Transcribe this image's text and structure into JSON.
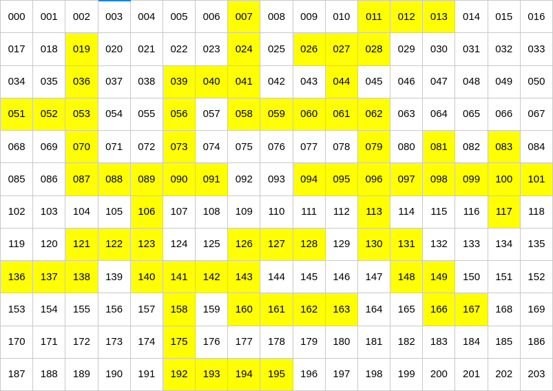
{
  "grid": {
    "columns": 17,
    "highlight_color": "#ffff00",
    "cells": [
      {
        "label": "000",
        "hl": false
      },
      {
        "label": "001",
        "hl": false
      },
      {
        "label": "002",
        "hl": false
      },
      {
        "label": "003",
        "hl": false
      },
      {
        "label": "004",
        "hl": false
      },
      {
        "label": "005",
        "hl": false
      },
      {
        "label": "006",
        "hl": false
      },
      {
        "label": "007",
        "hl": true
      },
      {
        "label": "008",
        "hl": false
      },
      {
        "label": "009",
        "hl": false
      },
      {
        "label": "010",
        "hl": false
      },
      {
        "label": "011",
        "hl": true
      },
      {
        "label": "012",
        "hl": true
      },
      {
        "label": "013",
        "hl": true
      },
      {
        "label": "014",
        "hl": false
      },
      {
        "label": "015",
        "hl": false
      },
      {
        "label": "016",
        "hl": false
      },
      {
        "label": "017",
        "hl": false
      },
      {
        "label": "018",
        "hl": false
      },
      {
        "label": "019",
        "hl": true
      },
      {
        "label": "020",
        "hl": false
      },
      {
        "label": "021",
        "hl": false
      },
      {
        "label": "022",
        "hl": false
      },
      {
        "label": "023",
        "hl": false
      },
      {
        "label": "024",
        "hl": true
      },
      {
        "label": "025",
        "hl": false
      },
      {
        "label": "026",
        "hl": true
      },
      {
        "label": "027",
        "hl": true
      },
      {
        "label": "028",
        "hl": true
      },
      {
        "label": "029",
        "hl": false
      },
      {
        "label": "030",
        "hl": false
      },
      {
        "label": "031",
        "hl": false
      },
      {
        "label": "032",
        "hl": false
      },
      {
        "label": "033",
        "hl": false
      },
      {
        "label": "034",
        "hl": false
      },
      {
        "label": "035",
        "hl": false
      },
      {
        "label": "036",
        "hl": true
      },
      {
        "label": "037",
        "hl": false
      },
      {
        "label": "038",
        "hl": false
      },
      {
        "label": "039",
        "hl": true
      },
      {
        "label": "040",
        "hl": true
      },
      {
        "label": "041",
        "hl": true
      },
      {
        "label": "042",
        "hl": false
      },
      {
        "label": "043",
        "hl": false
      },
      {
        "label": "044",
        "hl": true
      },
      {
        "label": "045",
        "hl": false
      },
      {
        "label": "046",
        "hl": false
      },
      {
        "label": "047",
        "hl": false
      },
      {
        "label": "048",
        "hl": false
      },
      {
        "label": "049",
        "hl": false
      },
      {
        "label": "050",
        "hl": false
      },
      {
        "label": "051",
        "hl": true
      },
      {
        "label": "052",
        "hl": true
      },
      {
        "label": "053",
        "hl": true
      },
      {
        "label": "054",
        "hl": false
      },
      {
        "label": "055",
        "hl": false
      },
      {
        "label": "056",
        "hl": true
      },
      {
        "label": "057",
        "hl": false
      },
      {
        "label": "058",
        "hl": true
      },
      {
        "label": "059",
        "hl": true
      },
      {
        "label": "060",
        "hl": true
      },
      {
        "label": "061",
        "hl": true
      },
      {
        "label": "062",
        "hl": true
      },
      {
        "label": "063",
        "hl": false
      },
      {
        "label": "064",
        "hl": false
      },
      {
        "label": "065",
        "hl": false
      },
      {
        "label": "066",
        "hl": false
      },
      {
        "label": "067",
        "hl": false
      },
      {
        "label": "068",
        "hl": false
      },
      {
        "label": "069",
        "hl": false
      },
      {
        "label": "070",
        "hl": true
      },
      {
        "label": "071",
        "hl": false
      },
      {
        "label": "072",
        "hl": false
      },
      {
        "label": "073",
        "hl": true
      },
      {
        "label": "074",
        "hl": false
      },
      {
        "label": "075",
        "hl": false
      },
      {
        "label": "076",
        "hl": false
      },
      {
        "label": "077",
        "hl": false
      },
      {
        "label": "078",
        "hl": false
      },
      {
        "label": "079",
        "hl": true
      },
      {
        "label": "080",
        "hl": false
      },
      {
        "label": "081",
        "hl": true
      },
      {
        "label": "082",
        "hl": false
      },
      {
        "label": "083",
        "hl": true
      },
      {
        "label": "084",
        "hl": false
      },
      {
        "label": "085",
        "hl": false
      },
      {
        "label": "086",
        "hl": false
      },
      {
        "label": "087",
        "hl": true
      },
      {
        "label": "088",
        "hl": true
      },
      {
        "label": "089",
        "hl": true
      },
      {
        "label": "090",
        "hl": true
      },
      {
        "label": "091",
        "hl": true
      },
      {
        "label": "092",
        "hl": false
      },
      {
        "label": "093",
        "hl": false
      },
      {
        "label": "094",
        "hl": true
      },
      {
        "label": "095",
        "hl": true
      },
      {
        "label": "096",
        "hl": true
      },
      {
        "label": "097",
        "hl": true
      },
      {
        "label": "098",
        "hl": true
      },
      {
        "label": "099",
        "hl": true
      },
      {
        "label": "100",
        "hl": true
      },
      {
        "label": "101",
        "hl": true
      },
      {
        "label": "102",
        "hl": false
      },
      {
        "label": "103",
        "hl": false
      },
      {
        "label": "104",
        "hl": false
      },
      {
        "label": "105",
        "hl": false
      },
      {
        "label": "106",
        "hl": true
      },
      {
        "label": "107",
        "hl": false
      },
      {
        "label": "108",
        "hl": false
      },
      {
        "label": "109",
        "hl": false
      },
      {
        "label": "110",
        "hl": false
      },
      {
        "label": "111",
        "hl": false
      },
      {
        "label": "112",
        "hl": false
      },
      {
        "label": "113",
        "hl": true
      },
      {
        "label": "114",
        "hl": false
      },
      {
        "label": "115",
        "hl": false
      },
      {
        "label": "116",
        "hl": false
      },
      {
        "label": "117",
        "hl": true
      },
      {
        "label": "118",
        "hl": false
      },
      {
        "label": "119",
        "hl": false
      },
      {
        "label": "120",
        "hl": false
      },
      {
        "label": "121",
        "hl": true
      },
      {
        "label": "122",
        "hl": true
      },
      {
        "label": "123",
        "hl": true
      },
      {
        "label": "124",
        "hl": false
      },
      {
        "label": "125",
        "hl": false
      },
      {
        "label": "126",
        "hl": true
      },
      {
        "label": "127",
        "hl": true
      },
      {
        "label": "128",
        "hl": true
      },
      {
        "label": "129",
        "hl": false
      },
      {
        "label": "130",
        "hl": true
      },
      {
        "label": "131",
        "hl": true
      },
      {
        "label": "132",
        "hl": false
      },
      {
        "label": "133",
        "hl": false
      },
      {
        "label": "134",
        "hl": false
      },
      {
        "label": "135",
        "hl": false
      },
      {
        "label": "136",
        "hl": true
      },
      {
        "label": "137",
        "hl": true
      },
      {
        "label": "138",
        "hl": true
      },
      {
        "label": "139",
        "hl": false
      },
      {
        "label": "140",
        "hl": true
      },
      {
        "label": "141",
        "hl": true
      },
      {
        "label": "142",
        "hl": true
      },
      {
        "label": "143",
        "hl": true
      },
      {
        "label": "144",
        "hl": false
      },
      {
        "label": "145",
        "hl": false
      },
      {
        "label": "146",
        "hl": false
      },
      {
        "label": "147",
        "hl": false
      },
      {
        "label": "148",
        "hl": true
      },
      {
        "label": "149",
        "hl": true
      },
      {
        "label": "150",
        "hl": false
      },
      {
        "label": "151",
        "hl": false
      },
      {
        "label": "152",
        "hl": false
      },
      {
        "label": "153",
        "hl": false
      },
      {
        "label": "154",
        "hl": false
      },
      {
        "label": "155",
        "hl": false
      },
      {
        "label": "156",
        "hl": false
      },
      {
        "label": "157",
        "hl": false
      },
      {
        "label": "158",
        "hl": true
      },
      {
        "label": "159",
        "hl": false
      },
      {
        "label": "160",
        "hl": true
      },
      {
        "label": "161",
        "hl": true
      },
      {
        "label": "162",
        "hl": true
      },
      {
        "label": "163",
        "hl": true
      },
      {
        "label": "164",
        "hl": false
      },
      {
        "label": "165",
        "hl": false
      },
      {
        "label": "166",
        "hl": true
      },
      {
        "label": "167",
        "hl": true
      },
      {
        "label": "168",
        "hl": false
      },
      {
        "label": "169",
        "hl": false
      },
      {
        "label": "170",
        "hl": false
      },
      {
        "label": "171",
        "hl": false
      },
      {
        "label": "172",
        "hl": false
      },
      {
        "label": "173",
        "hl": false
      },
      {
        "label": "174",
        "hl": false
      },
      {
        "label": "175",
        "hl": true
      },
      {
        "label": "176",
        "hl": false
      },
      {
        "label": "177",
        "hl": false
      },
      {
        "label": "178",
        "hl": false
      },
      {
        "label": "179",
        "hl": false
      },
      {
        "label": "180",
        "hl": false
      },
      {
        "label": "181",
        "hl": false
      },
      {
        "label": "182",
        "hl": false
      },
      {
        "label": "183",
        "hl": false
      },
      {
        "label": "184",
        "hl": false
      },
      {
        "label": "185",
        "hl": false
      },
      {
        "label": "186",
        "hl": false
      },
      {
        "label": "187",
        "hl": false
      },
      {
        "label": "188",
        "hl": false
      },
      {
        "label": "189",
        "hl": false
      },
      {
        "label": "190",
        "hl": false
      },
      {
        "label": "191",
        "hl": false
      },
      {
        "label": "192",
        "hl": true
      },
      {
        "label": "193",
        "hl": true
      },
      {
        "label": "194",
        "hl": true
      },
      {
        "label": "195",
        "hl": true
      },
      {
        "label": "196",
        "hl": false
      },
      {
        "label": "197",
        "hl": false
      },
      {
        "label": "198",
        "hl": false
      },
      {
        "label": "199",
        "hl": false
      },
      {
        "label": "200",
        "hl": false
      },
      {
        "label": "201",
        "hl": false
      },
      {
        "label": "202",
        "hl": false
      },
      {
        "label": "203",
        "hl": false
      }
    ]
  }
}
